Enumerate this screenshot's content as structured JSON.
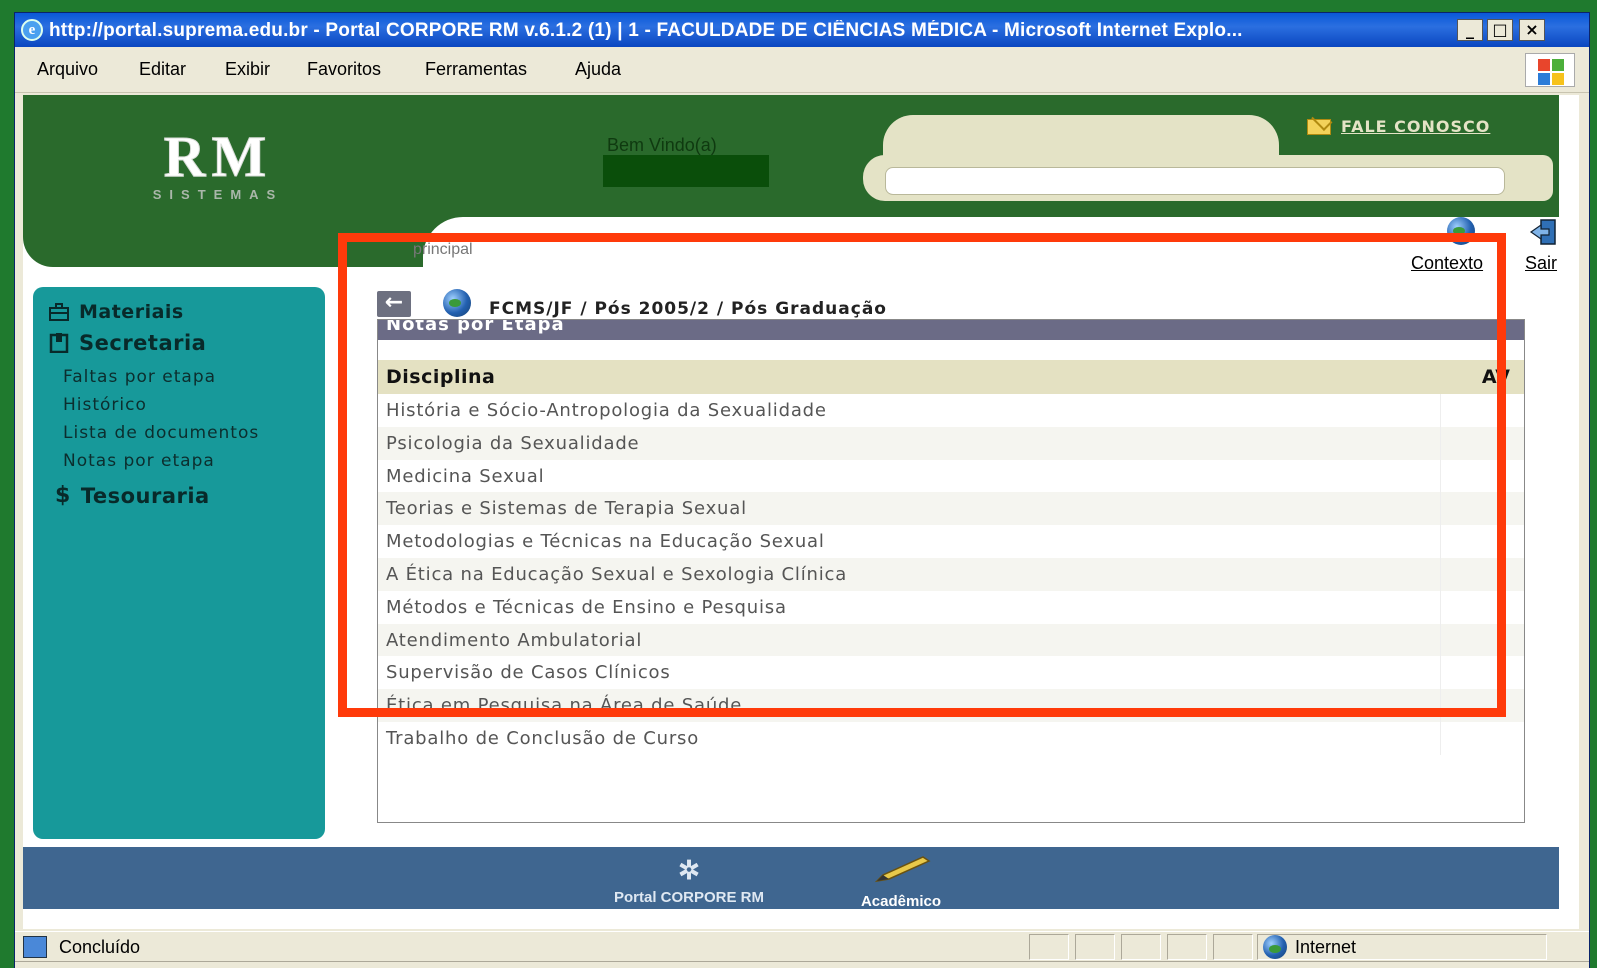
{
  "window": {
    "title": "http://portal.suprema.edu.br - Portal CORPORE RM v.6.1.2 (1) | 1 - FACULDADE DE CIÊNCIAS MÉDICA - Microsoft Internet Explo...",
    "minimize": "_",
    "maximize": "□",
    "close": "×"
  },
  "menu": [
    "Arquivo",
    "Editar",
    "Exibir",
    "Favoritos",
    "Ferramentas",
    "Ajuda"
  ],
  "header": {
    "logo_big": "RM",
    "logo_small": "SISTEMAS",
    "welcome": "Bem Vindo(a)",
    "contact": "FALE CONOSCO",
    "section_label": "principal",
    "context_label": "Contexto",
    "exit_label": "Sair"
  },
  "sidebar": {
    "materiais": "Materiais",
    "secretaria": "Secretaria",
    "links": [
      "Faltas por etapa",
      "Histórico",
      "Lista de documentos",
      "Notas por etapa"
    ],
    "tesouraria": "Tesouraria"
  },
  "breadcrumb": {
    "back": "←",
    "path": "FCMS/JF / Pós 2005/2  / Pós Graduação"
  },
  "panel": {
    "title": "Notas por Etapa",
    "columns": [
      "Disciplina",
      "AV"
    ],
    "rows": [
      "História e Sócio-Antropologia da Sexualidade",
      "Psicologia da Sexualidade",
      "Medicina Sexual",
      "Teorias e Sistemas de Terapia Sexual",
      "Metodologias e Técnicas na Educação Sexual",
      "A Ética na Educação Sexual e Sexologia Clínica",
      "Métodos e Técnicas de Ensino e Pesquisa",
      "Atendimento Ambulatorial",
      "Supervisão de Casos Clínicos",
      "Ética em Pesquisa na Área de Saúde",
      "Trabalho de Conclusão de Curso"
    ]
  },
  "footer": {
    "portal": "Portal CORPORE RM",
    "academico": "Acadêmico"
  },
  "status": {
    "done": "Concluído",
    "zone": "Internet"
  },
  "colors": {
    "highlight": "#ff3a0a",
    "header_green": "#2a6a2c",
    "sidebar_teal": "#17999a"
  }
}
